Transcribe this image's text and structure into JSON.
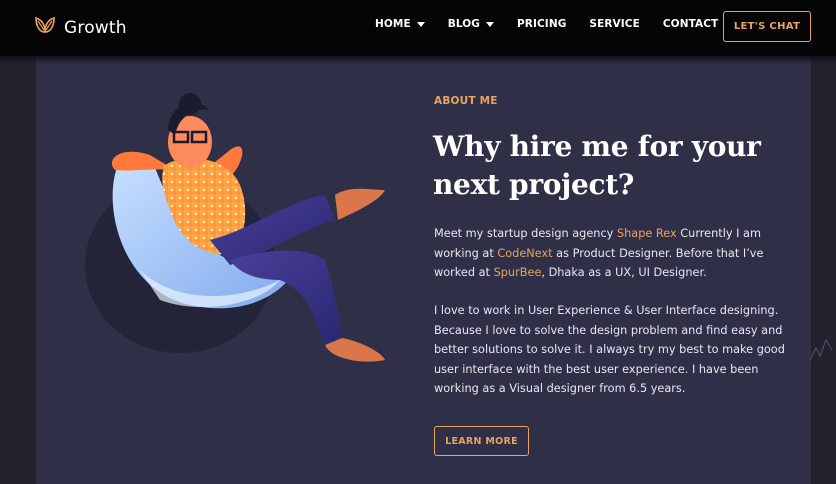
{
  "header": {
    "brand": "Growth",
    "nav": [
      {
        "label": "HOME",
        "has_dropdown": true
      },
      {
        "label": "BLOG",
        "has_dropdown": true
      },
      {
        "label": "PRICING",
        "has_dropdown": false
      },
      {
        "label": "SERVICE",
        "has_dropdown": false
      },
      {
        "label": "CONTACT",
        "has_dropdown": false
      }
    ],
    "cta": "LET'S CHAT"
  },
  "about": {
    "eyebrow": "ABOUT ME",
    "title": "Why hire me for your next project?",
    "para1": {
      "t1": "Meet my startup design agency ",
      "agency": "Shape Rex",
      "t2": " Currently I am working at ",
      "company": "CodeNext",
      "t3": " as Product Designer. Before that I’ve worked at ",
      "prev_company": "SpurBee",
      "t4": ", Dhaka as a UX, UI Designer."
    },
    "para2": "I love to work in User Experience & User Interface designing. Because I love to solve the design problem and find easy and better solutions to solve it. I always try my best to make good user interface with the best user experience. I have been working as a Visual designer from 6.5 years.",
    "button": "LEARN MORE"
  },
  "colors": {
    "accent": "#e8a45e",
    "panel": "#2f3048",
    "header_bg": "#050507",
    "page_bg": "#22222f"
  },
  "icons": {
    "logo": "leaf-icon",
    "dropdown": "caret-down-icon"
  }
}
